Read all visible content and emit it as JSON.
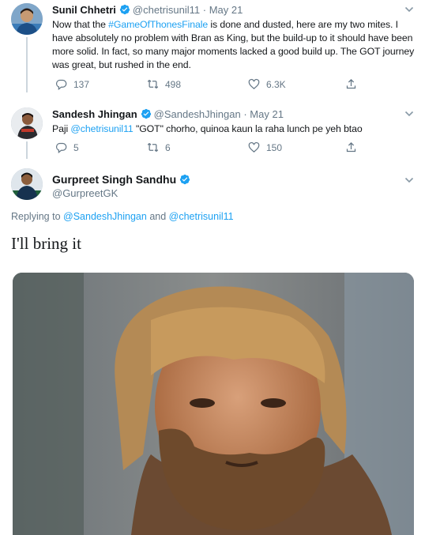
{
  "tweets": [
    {
      "name": "Sunil Chhetri",
      "handle": "@chetrisunil11",
      "separator": "·",
      "time": "May 21",
      "text_pre": "Now that the ",
      "hashtag": "#GameOfThonesFinale",
      "text_post": " is done and dusted, here are my two mites. I have absolutely no problem with Bran as King, but the build-up to it should have been more solid. In fact, so many major moments lacked a good build up. The GOT journey was great, but rushed in the end.",
      "replies": "137",
      "retweets": "498",
      "likes": "6.3K"
    },
    {
      "name": "Sandesh Jhingan",
      "handle": "@SandeshJhingan",
      "separator": "·",
      "time": "May 21",
      "text_pre": "Paji ",
      "mention": "@chetrisunil11",
      "text_post": " \"GOT\" chorho, quinoa kaun la raha lunch pe yeh btao",
      "replies": "5",
      "retweets": "6",
      "likes": "150"
    }
  ],
  "main_tweet": {
    "name": "Gurpreet Singh Sandhu",
    "handle": "@GurpreetGK",
    "replying_label": "Replying to ",
    "mention_1": "@SandeshJhingan",
    "and_label": " and ",
    "mention_2": "@chetrisunil11",
    "text": "I'll bring it"
  },
  "colors": {
    "link": "#1da1f2",
    "muted": "#657786",
    "verified": "#1da1f2",
    "divider": "#e6ecf0"
  },
  "icons": [
    "verified-badge-icon",
    "chevron-down-icon",
    "reply-icon",
    "retweet-icon",
    "like-icon",
    "share-icon"
  ]
}
